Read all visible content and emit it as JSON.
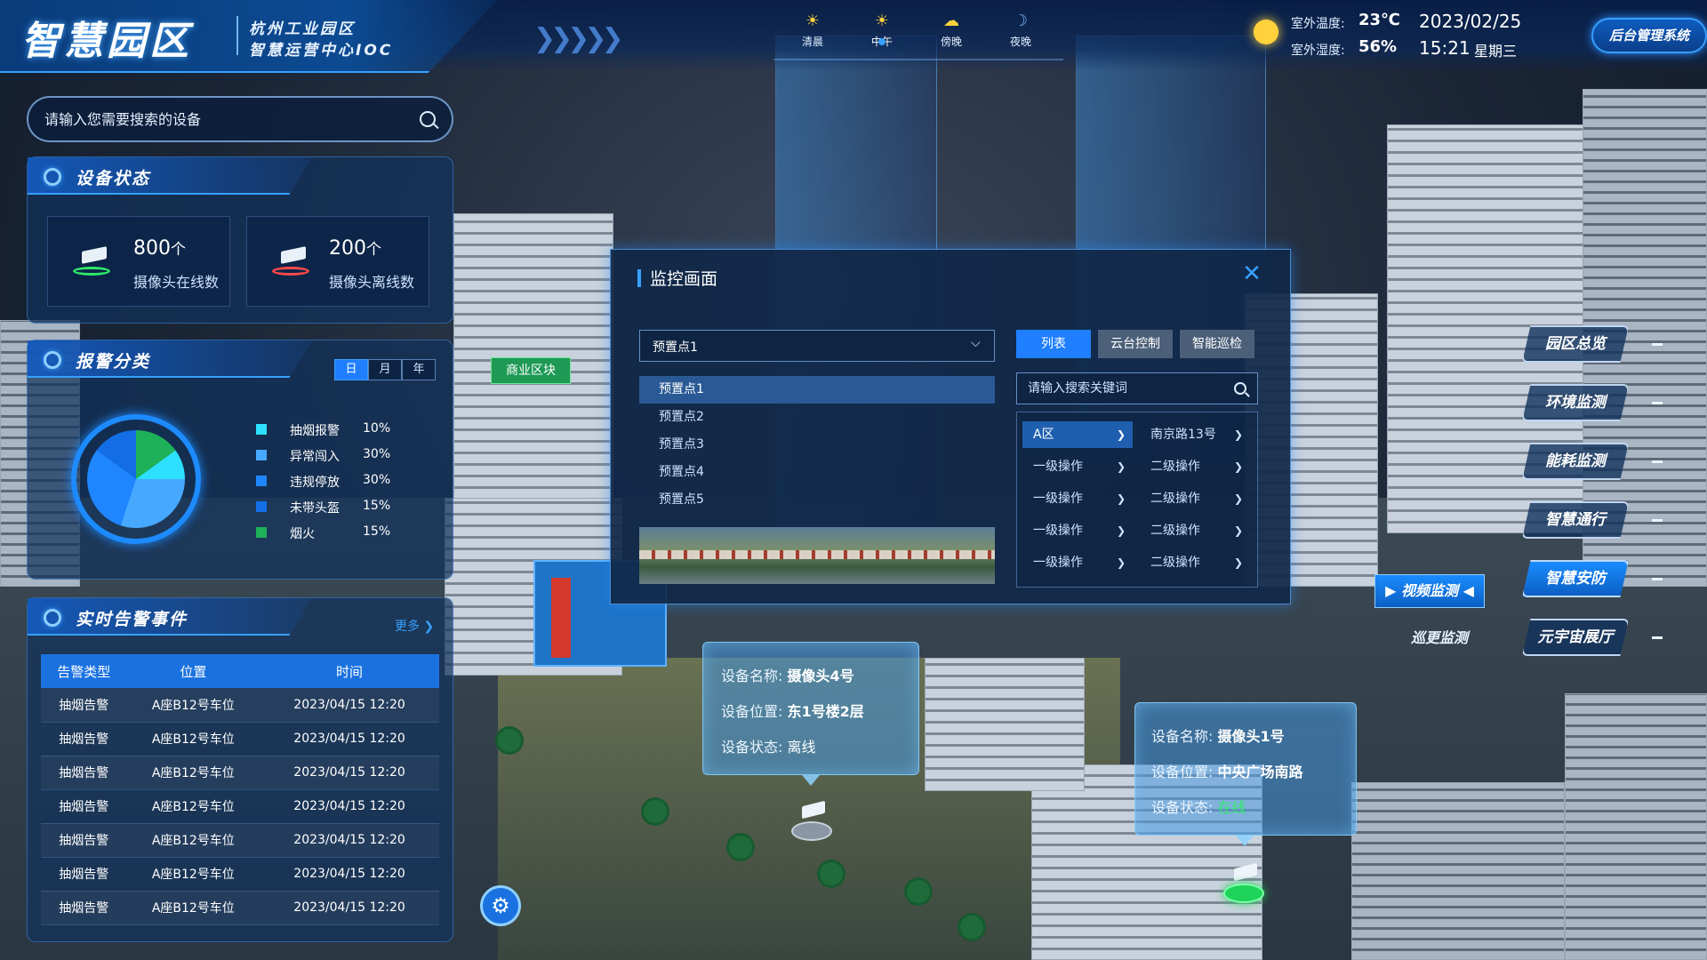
{
  "header": {
    "title": "智慧园区",
    "subtitle_line1": "杭州工业园区",
    "subtitle_line2": "智慧运营中心IOC",
    "time_tabs": [
      {
        "label": "清晨",
        "icon": "sunrise-icon",
        "active": false
      },
      {
        "label": "中午",
        "icon": "sun-icon",
        "active": true
      },
      {
        "label": "傍晚",
        "icon": "sunset-icon",
        "active": false
      },
      {
        "label": "夜晚",
        "icon": "moon-icon",
        "active": false
      }
    ],
    "weather": {
      "temp_label": "室外温度:",
      "temp_value": "23℃",
      "humidity_label": "室外湿度:",
      "humidity_value": "56%"
    },
    "date": "2023/02/25",
    "time": "15:21",
    "weekday": "星期三",
    "admin_button": "后台管理系统"
  },
  "search": {
    "placeholder": "请输入您需要搜索的设备"
  },
  "device_status": {
    "title": "设备状态",
    "online": {
      "count": "800",
      "unit": "个",
      "label": "摄像头在线数"
    },
    "offline": {
      "count": "200",
      "unit": "个",
      "label": "摄像头离线数"
    }
  },
  "alarm_category": {
    "title": "报警分类",
    "periods": [
      "日",
      "月",
      "年"
    ],
    "active_period": "日"
  },
  "chart_data": {
    "type": "pie",
    "categories": [
      "抽烟报警",
      "异常闯入",
      "违规停放",
      "未带头盔",
      "烟火"
    ],
    "values": [
      10,
      30,
      30,
      15,
      15
    ],
    "value_labels": [
      "10%",
      "30%",
      "30%",
      "15%",
      "15%"
    ],
    "colors": [
      "#2de0ff",
      "#46a9ff",
      "#1f86ff",
      "#136ee6",
      "#1fb05a"
    ]
  },
  "realtime_alarms": {
    "title": "实时告警事件",
    "more": "更多",
    "columns": [
      "告警类型",
      "位置",
      "时间"
    ],
    "rows": [
      [
        "抽烟告警",
        "A座B12号车位",
        "2023/04/15 12:20"
      ],
      [
        "抽烟告警",
        "A座B12号车位",
        "2023/04/15 12:20"
      ],
      [
        "抽烟告警",
        "A座B12号车位",
        "2023/04/15 12:20"
      ],
      [
        "抽烟告警",
        "A座B12号车位",
        "2023/04/15 12:20"
      ],
      [
        "抽烟告警",
        "A座B12号车位",
        "2023/04/15 12:20"
      ],
      [
        "抽烟告警",
        "A座B12号车位",
        "2023/04/15 12:20"
      ],
      [
        "抽烟告警",
        "A座B12号车位",
        "2023/04/15 12:20"
      ]
    ]
  },
  "scene": {
    "business_label": "商业区块"
  },
  "monitor_modal": {
    "title": "监控画面",
    "selected_preset": "预置点1",
    "presets": [
      "预置点1",
      "预置点2",
      "预置点3",
      "预置点4",
      "预置点5"
    ],
    "tabs": [
      "列表",
      "云台控制",
      "智能巡检"
    ],
    "active_tab": "列表",
    "keyword_placeholder": "请输入搜索关键词",
    "tree": [
      [
        "A区",
        "南京路13号"
      ],
      [
        "一级操作",
        "二级操作"
      ],
      [
        "一级操作",
        "二级操作"
      ],
      [
        "一级操作",
        "二级操作"
      ],
      [
        "一级操作",
        "二级操作"
      ]
    ]
  },
  "popup_cam4": {
    "name_label": "设备名称:",
    "name": "摄像头4号",
    "loc_label": "设备位置:",
    "location": "东1号楼2层",
    "status_label": "设备状态:",
    "status": "离线"
  },
  "popup_cam1": {
    "name_label": "设备名称:",
    "name": "摄像头1号",
    "loc_label": "设备位置:",
    "location": "中央广场南路",
    "status_label": "设备状态:",
    "status": "在线"
  },
  "right_nav": {
    "items": [
      "园区总览",
      "环境监测",
      "能耗监测",
      "智慧通行",
      "智慧安防",
      "元宇宙展厅"
    ],
    "active": "智慧安防",
    "sub_items": [
      "视频监测",
      "巡更监测"
    ],
    "active_sub": "视频监测"
  }
}
